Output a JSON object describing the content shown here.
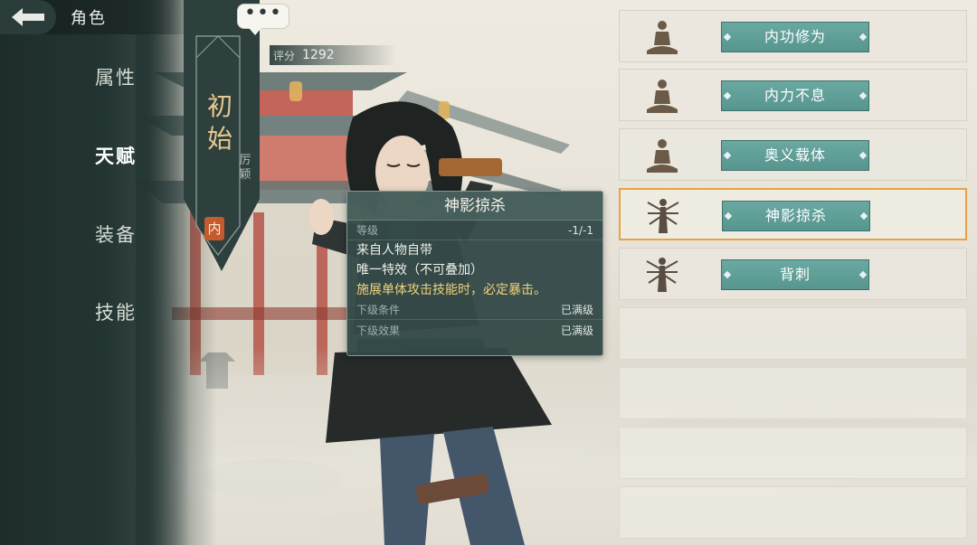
{
  "header": {
    "title": "角色"
  },
  "nav": {
    "items": [
      {
        "label": "属性"
      },
      {
        "label": "天赋"
      },
      {
        "label": "装备"
      },
      {
        "label": "技能"
      }
    ]
  },
  "rank": {
    "title": "初始",
    "subtitle": "厉颖",
    "badge": "内"
  },
  "chat": {
    "label": "•••"
  },
  "score": {
    "label": "评分",
    "value": "1292"
  },
  "tooltip": {
    "title": "神影掠杀",
    "level_label": "等级",
    "level_value": "-1/-1",
    "line1": "来自人物自带",
    "line2": "唯一特效（不可叠加）",
    "line3": "施展单体攻击技能时，必定暴击。",
    "next_cond_label": "下级条件",
    "next_cond_value": "已满级",
    "next_effect_label": "下级效果",
    "next_effect_value": "已满级"
  },
  "skills": [
    {
      "label": "内功修为",
      "icon": "meditation-icon"
    },
    {
      "label": "内力不息",
      "icon": "meditation-icon"
    },
    {
      "label": "奥义载体",
      "icon": "meditation-icon"
    },
    {
      "label": "神影掠杀",
      "icon": "multi-arm-icon",
      "selected": true
    },
    {
      "label": "背刺",
      "icon": "multi-arm-icon"
    }
  ],
  "colors": {
    "accent": "#e8a14a",
    "button": "#5f9f99",
    "panel": "#233533",
    "rank_gold": "#e9c98a"
  }
}
